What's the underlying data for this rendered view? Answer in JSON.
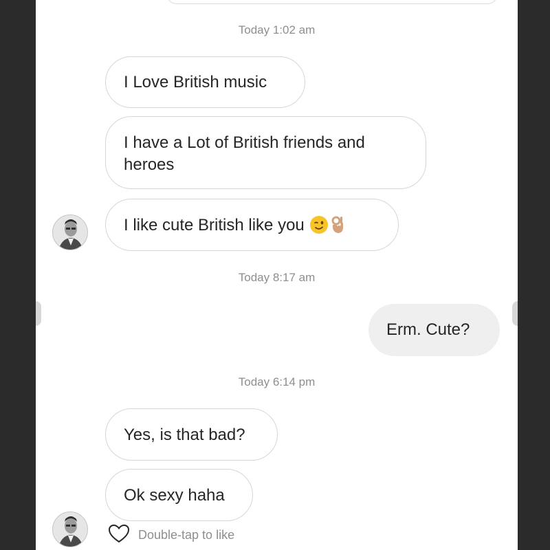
{
  "conversation": {
    "timestamps": [
      "Today 1:02 am",
      "Today 8:17 am",
      "Today 6:14 pm"
    ],
    "messages": [
      {
        "text": "I Love British music"
      },
      {
        "lines": [
          "I have  a Lot of British friends and",
          "heroes"
        ]
      },
      {
        "text": "I like cute British like you",
        "emojis": [
          "winking-face",
          "ok-hand"
        ]
      },
      {
        "text": "Erm.  Cute?"
      },
      {
        "text": "Yes, is that bad?"
      },
      {
        "text": "Ok sexy haha"
      }
    ]
  },
  "footer": {
    "like_hint": "Double-tap to like",
    "icon": "heart-outline"
  },
  "colors": {
    "incoming_border": "#d6d6d6",
    "outgoing_bg": "#efefef",
    "timestamp": "#8e8e8e",
    "text": "#262626",
    "frame": "#2b2b2b"
  }
}
